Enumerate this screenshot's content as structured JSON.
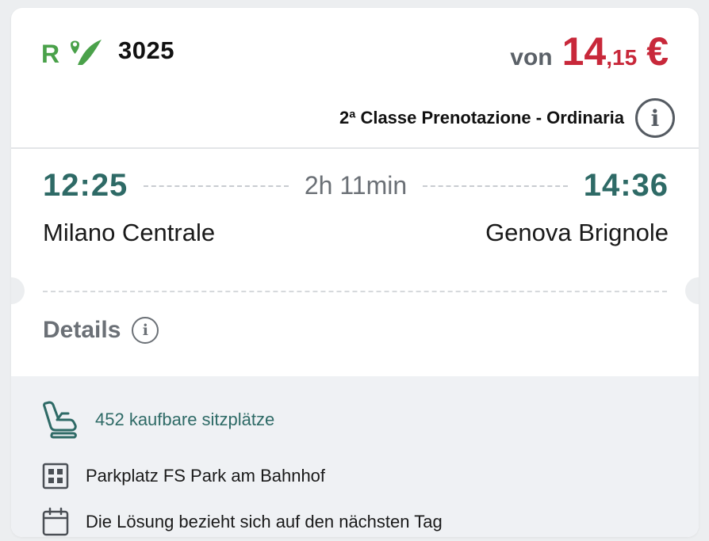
{
  "train": {
    "number": "3025",
    "brand_icon": "regionale-veloce-logo"
  },
  "price": {
    "from_label": "von",
    "integer": "14",
    "decimal": ",15",
    "currency": "€",
    "color": "#c8283a"
  },
  "fare": {
    "label": "2ª Classe Prenotazione - Ordinaria",
    "info_icon": "i"
  },
  "journey": {
    "departure_time": "12:25",
    "arrival_time": "14:36",
    "duration": "2h 11min",
    "origin": "Milano Centrale",
    "destination": "Genova Brignole",
    "time_color": "#2e6a66"
  },
  "details": {
    "label": "Details",
    "info_icon": "i"
  },
  "features": {
    "seats": "452 kaufbare sitzplätze",
    "parking": "Parkplatz FS Park am Bahnhof",
    "next_day": "Die Lösung bezieht sich auf den nächsten Tag"
  }
}
